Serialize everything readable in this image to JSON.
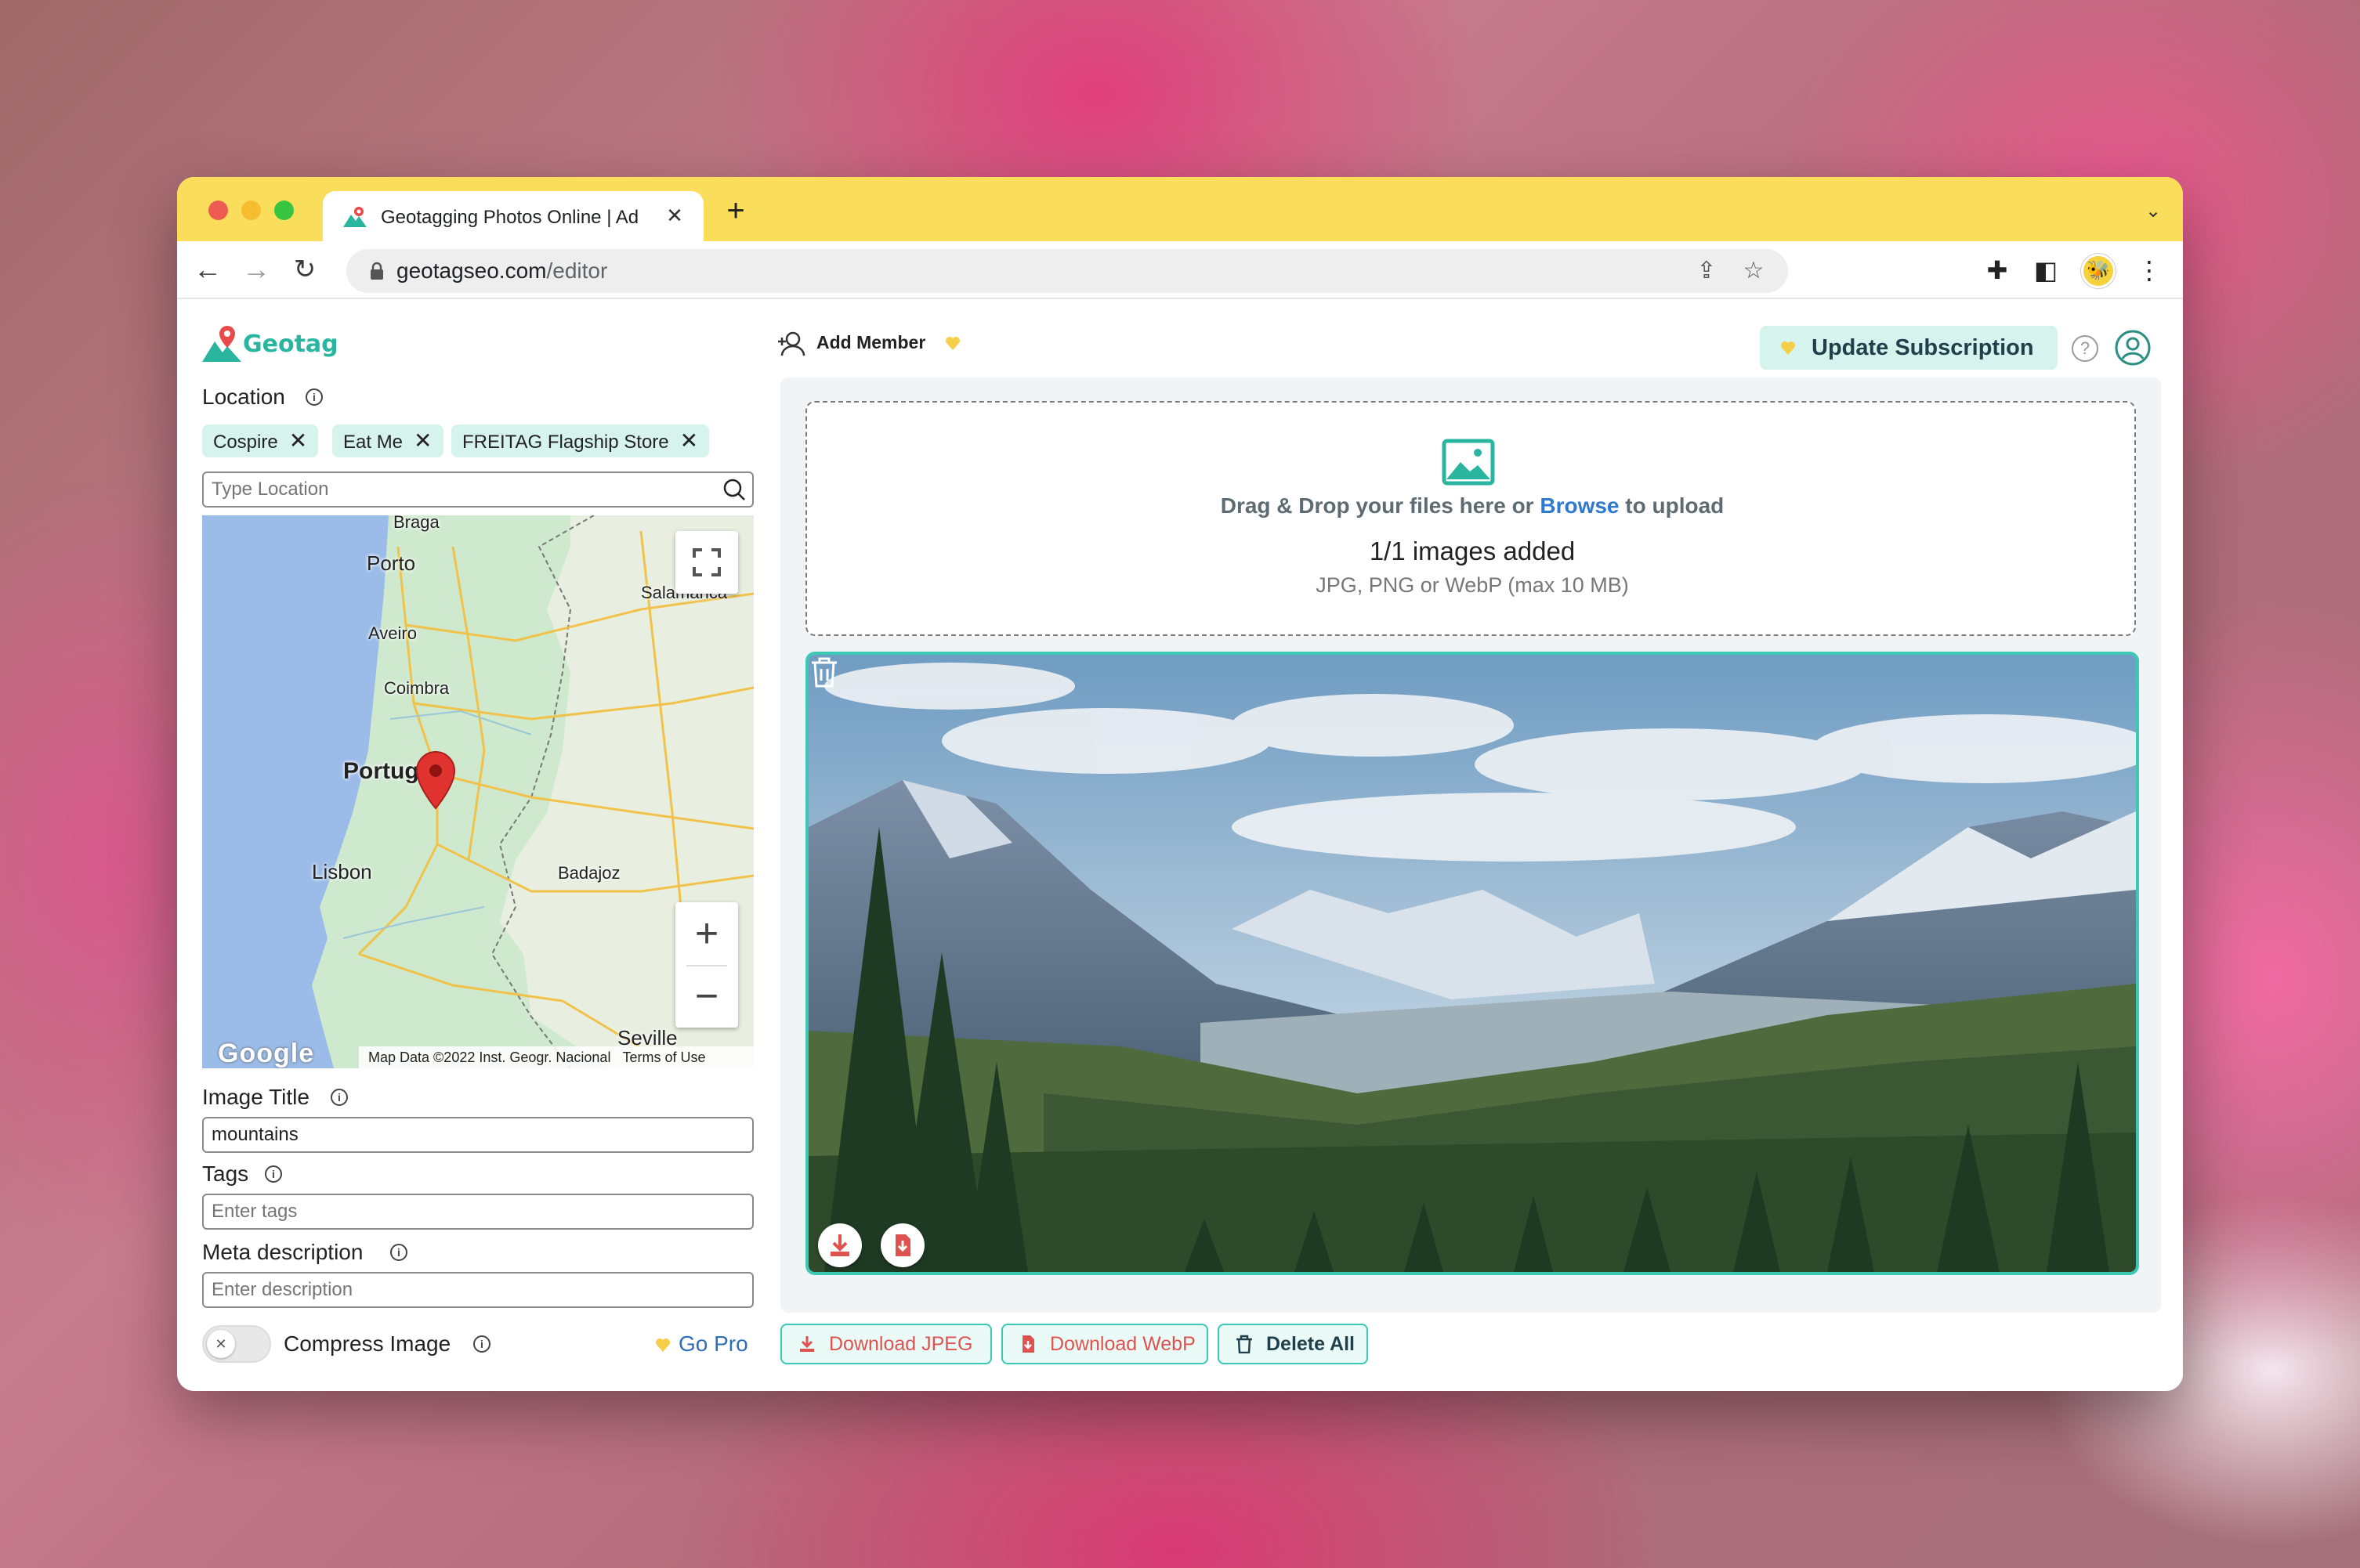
{
  "browser": {
    "tab_title": "Geotagging Photos Online | Ad",
    "new_tab": "+",
    "url_host": "geotagseo.com",
    "url_path": "/editor"
  },
  "app": {
    "logo_text": "Geotag",
    "location_label": "Location",
    "location_chips": [
      "Cospire",
      "Eat Me",
      "FREITAG Flagship Store"
    ],
    "location_placeholder": "Type Location",
    "map": {
      "labels": [
        "Braga",
        "Porto",
        "Salamanca",
        "Aveiro",
        "Coimbra",
        "Portugal",
        "Lisbon",
        "Badajoz",
        "Seville"
      ],
      "credit": "Map Data ©2022 Inst. Geogr. Nacional",
      "terms": "Terms of Use",
      "google": "Google"
    },
    "image_title_label": "Image Title",
    "image_title_value": "mountains",
    "tags_label": "Tags",
    "tags_placeholder": "Enter tags",
    "meta_label": "Meta description",
    "meta_placeholder": "Enter description",
    "compress_label": "Compress Image",
    "go_pro": "Go Pro"
  },
  "header": {
    "add_member": "Add Member",
    "update_subscription": "Update Subscription",
    "help": "?"
  },
  "upload": {
    "drop_prefix": "Drag & Drop your files here or ",
    "browse": "Browse",
    "drop_suffix": " to upload",
    "count": "1/1 images added",
    "formats": "JPG, PNG or WebP (max 10 MB)"
  },
  "actions": {
    "download_jpeg": "Download JPEG",
    "download_webp": "Download WebP",
    "delete_all": "Delete All"
  },
  "colors": {
    "accent": "#3cc9b4",
    "titlebar": "#fbdd5c",
    "link": "#2f7ad1",
    "danger": "#e0524f"
  }
}
